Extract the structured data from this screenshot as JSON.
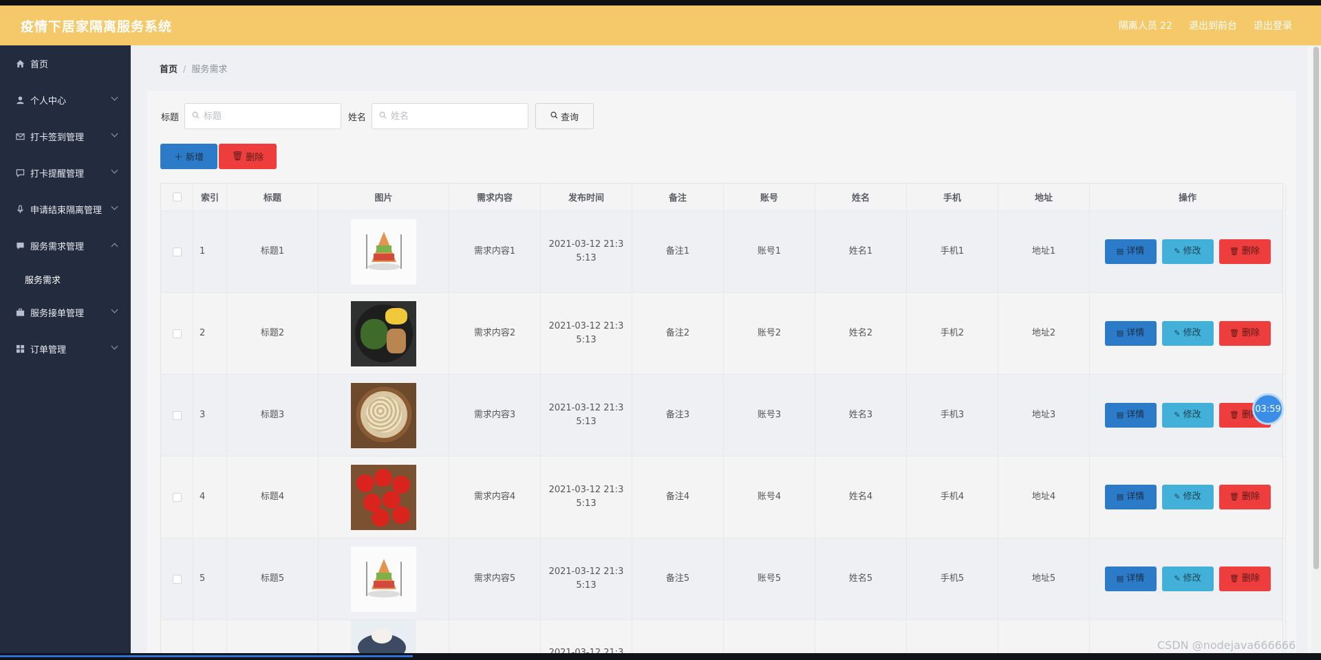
{
  "header": {
    "title": "疫情下居家隔离服务系统",
    "user": "隔离人员 22",
    "back_front": "退出到前台",
    "logout": "退出登录"
  },
  "sidebar": {
    "items": [
      {
        "label": "首页",
        "icon": "home-icon"
      },
      {
        "label": "个人中心",
        "icon": "user-icon"
      },
      {
        "label": "打卡签到管理",
        "icon": "mail-icon"
      },
      {
        "label": "打卡提醒管理",
        "icon": "chat-icon"
      },
      {
        "label": "申请结束隔离管理",
        "icon": "mic-icon"
      },
      {
        "label": "服务需求管理",
        "icon": "message-icon"
      },
      {
        "label": "服务需求",
        "icon": ""
      },
      {
        "label": "服务接单管理",
        "icon": "briefcase-icon"
      },
      {
        "label": "订单管理",
        "icon": "grid-icon"
      }
    ]
  },
  "breadcrumb": {
    "home": "首页",
    "current": "服务需求"
  },
  "search": {
    "title_label": "标题",
    "title_placeholder": "标题",
    "name_label": "姓名",
    "name_placeholder": "姓名",
    "query_label": "查询"
  },
  "actions": {
    "add": "新增",
    "delete": "删除"
  },
  "table": {
    "headers": [
      "索引",
      "标题",
      "图片",
      "需求内容",
      "发布时间",
      "备注",
      "账号",
      "姓名",
      "手机",
      "地址",
      "操作"
    ],
    "rows": [
      {
        "index": "1",
        "title": "标题1",
        "image": "food-pyramid",
        "content": "需求内容1",
        "time": "2021-03-12 21:35:13",
        "note": "备注1",
        "account": "账号1",
        "name": "姓名1",
        "phone": "手机1",
        "address": "地址1"
      },
      {
        "index": "2",
        "title": "标题2",
        "image": "salad-plate",
        "content": "需求内容2",
        "time": "2021-03-12 21:35:13",
        "note": "备注2",
        "account": "账号2",
        "name": "姓名2",
        "phone": "手机2",
        "address": "地址2"
      },
      {
        "index": "3",
        "title": "标题3",
        "image": "oats-bowl",
        "content": "需求内容3",
        "time": "2021-03-12 21:35:13",
        "note": "备注3",
        "account": "账号3",
        "name": "姓名3",
        "phone": "手机3",
        "address": "地址3"
      },
      {
        "index": "4",
        "title": "标题4",
        "image": "tomatoes",
        "content": "需求内容4",
        "time": "2021-03-12 21:35:13",
        "note": "备注4",
        "account": "账号4",
        "name": "姓名4",
        "phone": "手机4",
        "address": "地址4"
      },
      {
        "index": "5",
        "title": "标题5",
        "image": "food-pyramid",
        "content": "需求内容5",
        "time": "2021-03-12 21:35:13",
        "note": "备注5",
        "account": "账号5",
        "name": "姓名5",
        "phone": "手机5",
        "address": "地址5"
      }
    ],
    "partial_time": "2021-03-12 21:3",
    "op_detail": "详情",
    "op_edit": "修改",
    "op_delete": "删除"
  },
  "overlay": {
    "timer": "03:59",
    "watermark": "CSDN @nodejava666666"
  },
  "colors": {
    "header": "#f5c96a",
    "sidebar": "#232b3e",
    "primary": "#2b7bc8",
    "danger": "#ee3d3d",
    "info": "#42b0d8"
  }
}
